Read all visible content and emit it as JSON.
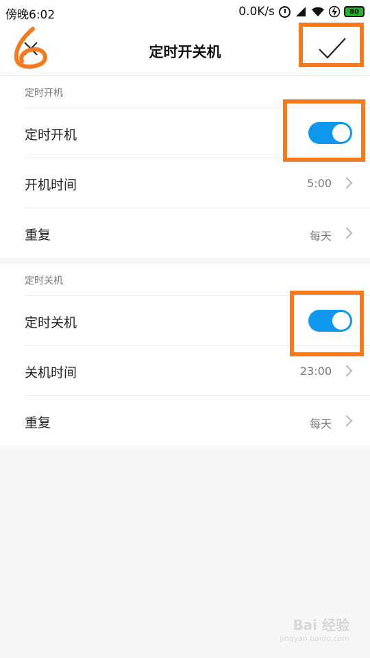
{
  "status_bar": {
    "time": "傍晚6:02",
    "network_speed": "0.0K/s",
    "battery_level": "80",
    "icons": [
      "alarm-icon",
      "signal-icon",
      "wifi-icon",
      "bolt-icon",
      "battery-icon"
    ]
  },
  "header": {
    "title": "定时开关机",
    "close_icon": "close-icon",
    "confirm_icon": "check-icon"
  },
  "power_on_section": {
    "header": "定时开机",
    "toggle_label": "定时开机",
    "toggle_on": true,
    "time_label": "开机时间",
    "time_value": "5:00",
    "repeat_label": "重复",
    "repeat_value": "每天"
  },
  "power_off_section": {
    "header": "定时关机",
    "toggle_label": "定时关机",
    "toggle_on": true,
    "time_label": "关机时间",
    "time_value": "23:00",
    "repeat_label": "重复",
    "repeat_value": "每天"
  },
  "annotation": {
    "step_number": "6",
    "color": "#f47a1f"
  },
  "watermark": {
    "text": "Bai 经验",
    "sub": "jingyan.baidu.com"
  },
  "colors": {
    "toggle_on": "#0f97ee",
    "background": "#f7f7f7"
  }
}
